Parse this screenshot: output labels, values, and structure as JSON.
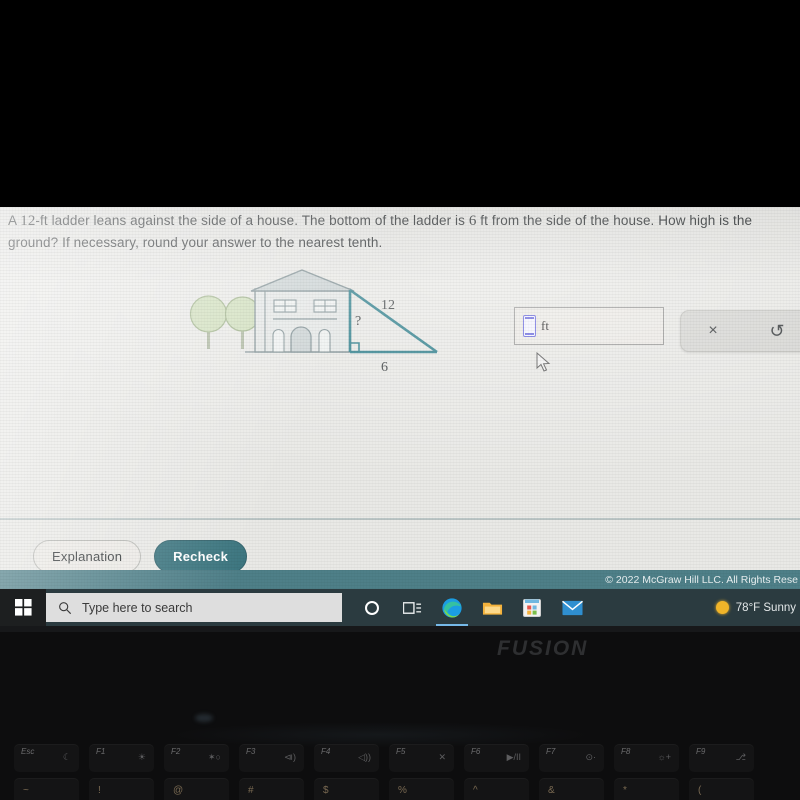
{
  "question": {
    "line1_a": "A ",
    "line1_num1": "12",
    "line1_b": "-ft ladder leans against the side of a house. The bottom of the ladder is ",
    "line1_num2": "6",
    "line1_c": " ft from the side of the house. How high is the ",
    "line2": "ground? If necessary, round your answer to the nearest tenth."
  },
  "figure": {
    "label_hypotenuse": "12",
    "label_vertical": "?",
    "label_base": "6",
    "house_fill": "#e4e7e6",
    "roof_fill": "#c9d1d2",
    "tree_fill": "#cdddb8",
    "line_color": "#2e7f8c",
    "outline_color": "#7d8e92"
  },
  "answer": {
    "placeholder_slot": "math-entry-box",
    "unit": "ft",
    "value": ""
  },
  "tools": {
    "clear_label": "×",
    "undo_label": "↺"
  },
  "actions": {
    "explanation": "Explanation",
    "recheck": "Recheck"
  },
  "footer": {
    "copyright": "© 2022 McGraw Hill LLC. All Rights Rese"
  },
  "taskbar": {
    "search_placeholder": "Type here to search",
    "icons": [
      {
        "name": "cortana-icon"
      },
      {
        "name": "task-view-icon"
      },
      {
        "name": "edge-icon"
      },
      {
        "name": "file-explorer-icon"
      },
      {
        "name": "microsoft-store-icon"
      },
      {
        "name": "mail-icon"
      }
    ],
    "weather": "78°F  Sunny"
  },
  "laptop": {
    "brand": "FUSION",
    "fn_keys": [
      {
        "label": "Esc",
        "glyph": "☾"
      },
      {
        "label": "F1",
        "glyph": "☀"
      },
      {
        "label": "F2",
        "glyph": "✶○"
      },
      {
        "label": "F3",
        "glyph": "⧏)"
      },
      {
        "label": "F4",
        "glyph": "◁))"
      },
      {
        "label": "F5",
        "glyph": "✕"
      },
      {
        "label": "F6",
        "glyph": "▶/II"
      },
      {
        "label": "F7",
        "glyph": "⊙·"
      },
      {
        "label": "F8",
        "glyph": "☼+"
      },
      {
        "label": "F9",
        "glyph": "⎇"
      }
    ],
    "num_keys": [
      "~",
      "!",
      "@",
      "#",
      "$",
      "%",
      "^",
      "&",
      "*",
      "("
    ]
  }
}
